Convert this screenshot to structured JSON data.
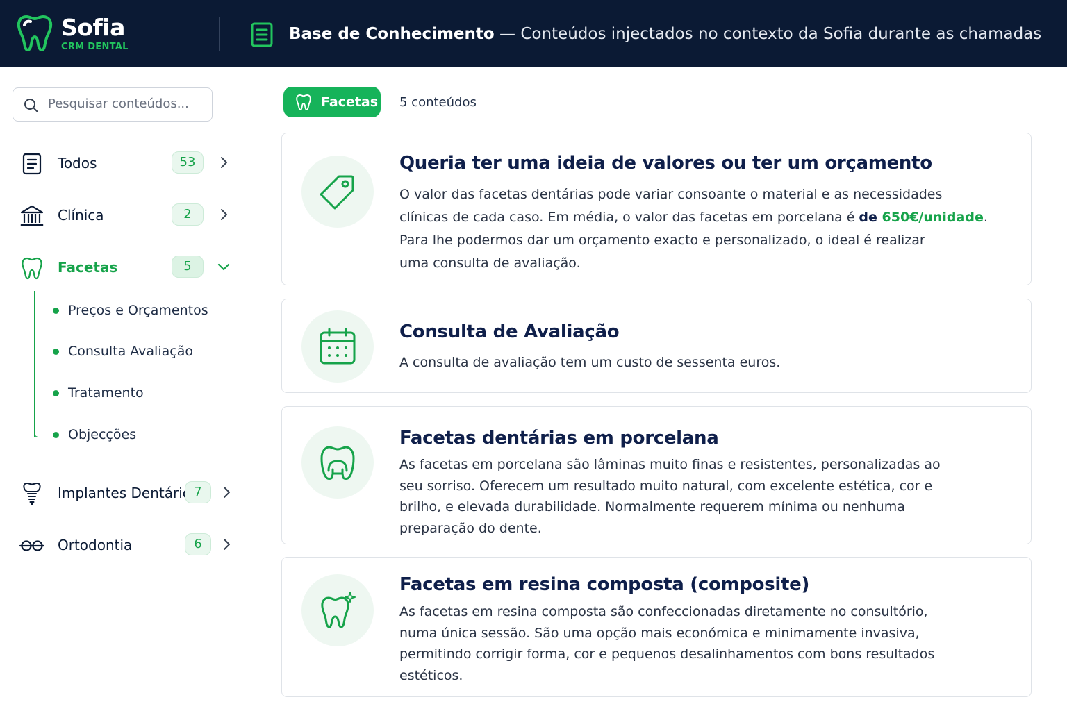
{
  "app": {
    "name": "Sofia",
    "subtitle": "CRM DENTAL",
    "header_title_bold": "Base de Conhecimento",
    "header_title_rest": " — Conteúdos injectados no contexto da Sofia durante as chamadas"
  },
  "search": {
    "placeholder": "Pesquisar conteúdos..."
  },
  "sidebar": {
    "items": [
      {
        "label": "Todos",
        "count": "53",
        "icon": "document-icon"
      },
      {
        "label": "Clínica",
        "count": "2",
        "icon": "building-icon"
      },
      {
        "label": "Facetas",
        "count": "5",
        "icon": "tooth-icon",
        "active": true
      },
      {
        "label": "Implantes Dentários",
        "count": "7",
        "icon": "implant-icon"
      },
      {
        "label": "Ortodontia",
        "count": "6",
        "icon": "braces-icon"
      }
    ],
    "subitems": [
      {
        "label": "Preços e Orçamentos"
      },
      {
        "label": "Consulta Avaliação"
      },
      {
        "label": "Tratamento"
      },
      {
        "label": "Objecções"
      }
    ]
  },
  "main": {
    "chip_label": "Facetas",
    "count_label": "5 conteúdos",
    "cards": [
      {
        "title": "Queria ter uma ideia de valores ou ter um orçamento",
        "icon": "price-tag-icon",
        "line1": "O valor das facetas dentárias pode variar consoante o material e as necessidades",
        "line2_pre": "clínicas de cada caso. Em média, o valor das facetas em porcelana é ",
        "line2_de": "de ",
        "line2_price": "650€/unidade",
        "line2_post": ".",
        "line3": "Para lhe podermos dar um orçamento exacto e personalizado, o ideal é realizar",
        "line4": "uma consulta de avaliação."
      },
      {
        "title": "Consulta de Avaliação",
        "icon": "calendar-icon",
        "line1": "A consulta de avaliação tem um custo de sessenta euros."
      },
      {
        "title": "Facetas dentárias em porcelana",
        "icon": "veneer-icon",
        "line1": "As facetas em porcelana são lâminas muito finas e resistentes, personalizadas ao",
        "line2": "seu sorriso. Oferecem um resultado muito natural, com excelente estética, cor e",
        "line3": "brilho, e elevada durabilidade. Normalmente requerem mínima ou nenhuma",
        "line4": "preparação do dente."
      },
      {
        "title": "Facetas em resina composta (composite)",
        "icon": "sparkle-tooth-icon",
        "line1": "As facetas em resina composta são confeccionadas diretamente no consultório,",
        "line2": "numa única sessão. São uma opção mais económica e minimamente invasiva,",
        "line3": "permitindo corrigir forma, cor e pequenos desalinhamentos com bons resultados",
        "line4": "estéticos."
      }
    ]
  },
  "colors": {
    "header_bg": "#0b1a34",
    "accent_green": "#16a34a",
    "chip_green": "#16b35a",
    "title_navy": "#0f1f4a"
  }
}
